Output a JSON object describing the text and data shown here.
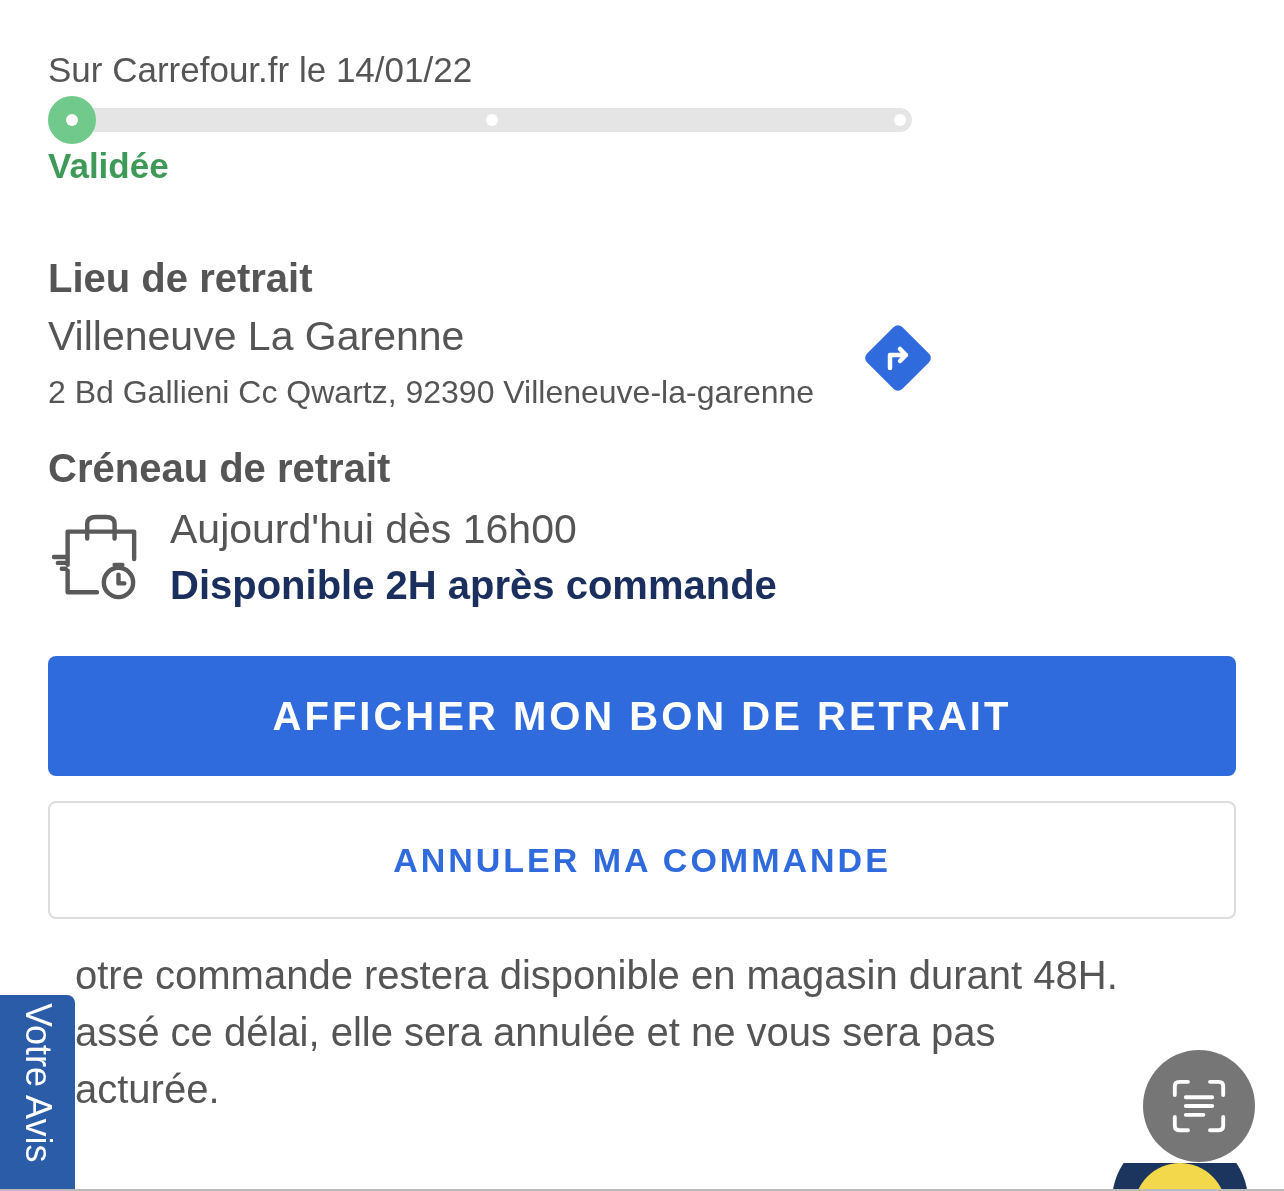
{
  "order": {
    "origin": "Sur Carrefour.fr le 14/01/22",
    "steps": [
      {
        "selected": true
      },
      {
        "selected": false
      },
      {
        "selected": false
      }
    ],
    "status": "Validée"
  },
  "pickup_place": {
    "heading": "Lieu de retrait",
    "store": "Villeneuve La Garenne",
    "address": "2 Bd Gallieni Cc Qwartz, 92390 Villeneuve-la-garenne"
  },
  "pickup_slot": {
    "heading": "Créneau de retrait",
    "time": "Aujourd'hui dès 16h00",
    "availability": "Disponible 2H après commande"
  },
  "buttons": [
    {
      "kind": "primary",
      "label": "AFFICHER MON BON DE RETRAIT"
    },
    {
      "kind": "secondary",
      "label": "ANNULER MA COMMANDE"
    }
  ],
  "notice_lines": [
    "otre commande restera disponible en magasin durant 48H.",
    "assé ce délai, elle sera annulée et ne vous sera pas",
    "acturée."
  ],
  "feedback_tab": "Votre Avis"
}
